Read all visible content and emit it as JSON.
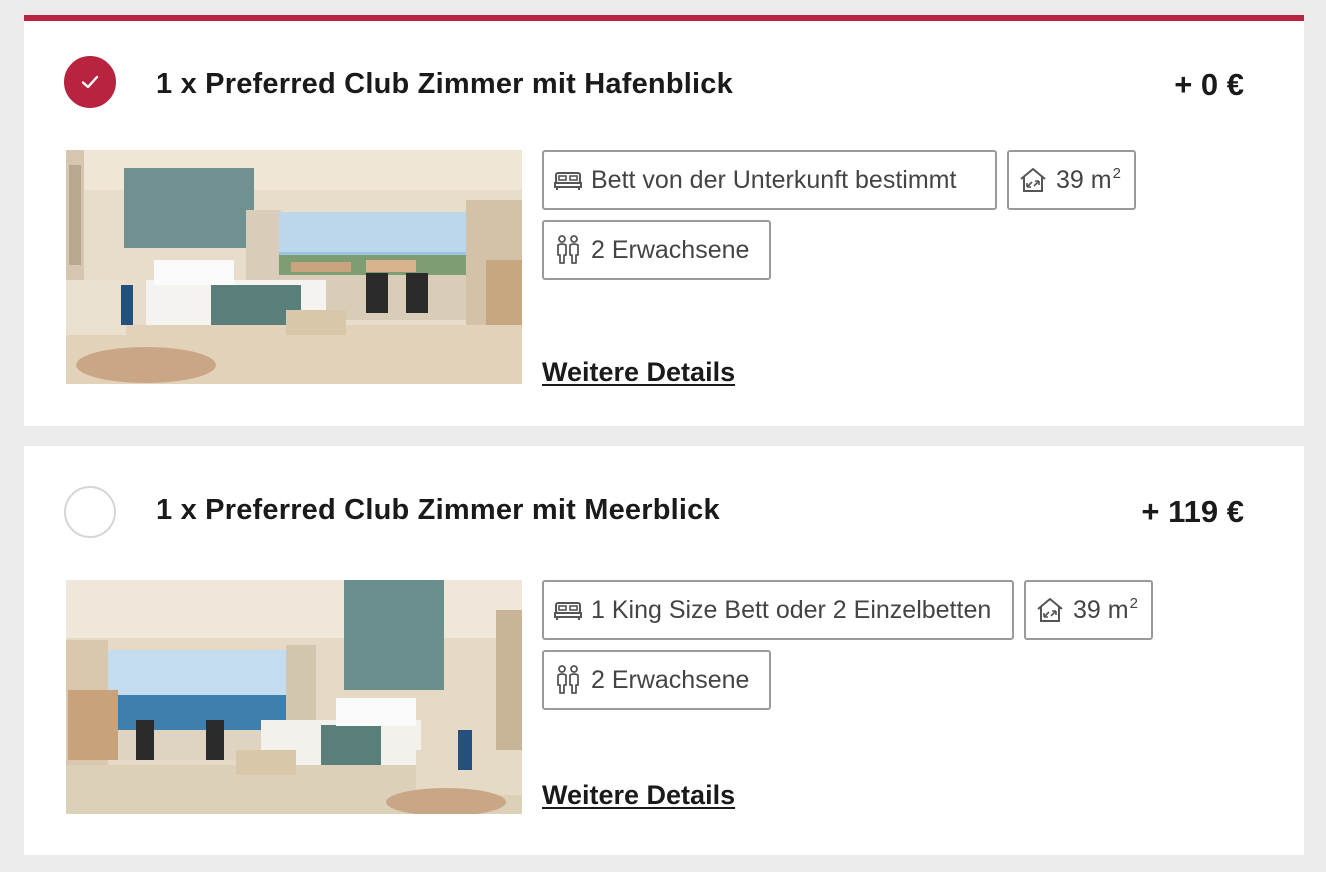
{
  "rooms": [
    {
      "selected": true,
      "title": "1 x Preferred Club Zimmer mit Hafenblick",
      "price": "+ 0 €",
      "bed": "Bett von der Unterkunft bestimmt",
      "size_value": "39 m",
      "size_sup": "2",
      "guests": "2 Erwachsene",
      "details_label": "Weitere Details",
      "photo_view": "harbor-view"
    },
    {
      "selected": false,
      "title": "1 x Preferred Club Zimmer mit Meerblick",
      "price": "+ 119 €",
      "bed": "1 King Size Bett oder 2 Einzelbetten",
      "size_value": "39 m",
      "size_sup": "2",
      "guests": "2 Erwachsene",
      "details_label": "Weitere Details",
      "photo_view": "ocean-view"
    }
  ],
  "icons": {
    "radio_checked": "checkmark-icon",
    "bed": "bed-icon",
    "size": "room-size-icon",
    "guests": "adults-icon"
  },
  "colors": {
    "accent": "#b8233f",
    "page_background": "#ebebeb",
    "card_background": "#ffffff",
    "tag_border": "#9a9a9a"
  }
}
